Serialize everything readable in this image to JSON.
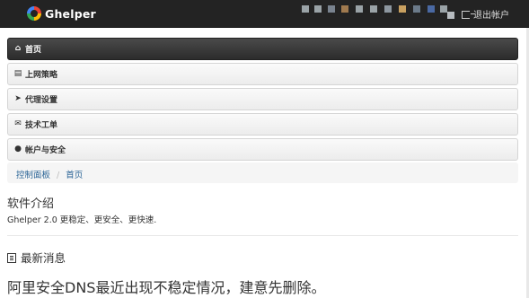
{
  "header": {
    "brand": "Ghelper",
    "logout_label": "退出帐户",
    "blocks": [
      {
        "color": "#9aa3a7"
      },
      {
        "color": "#9aa3a7"
      },
      {
        "color": "#79838f"
      },
      {
        "color": "#a07a4f"
      },
      {
        "color": "#9aa3a7"
      },
      {
        "color": "#9aa3a7"
      },
      {
        "color": "#8d97a0"
      },
      {
        "color": "#c8a060"
      },
      {
        "color": "#6b7a89"
      },
      {
        "color": "#4a69a3"
      },
      {
        "color": "#9aa3a7"
      },
      {
        "color": "#b7bcc0"
      }
    ]
  },
  "nav": {
    "items": [
      {
        "label": "首页",
        "icon": "home-icon",
        "active": true
      },
      {
        "label": "上网策略",
        "icon": "list-icon",
        "active": false
      },
      {
        "label": "代理设置",
        "icon": "send-icon",
        "active": false
      },
      {
        "label": "技术工单",
        "icon": "envelope-icon",
        "active": false
      },
      {
        "label": "帐户与安全",
        "icon": "user-icon",
        "active": false
      }
    ]
  },
  "breadcrumb": {
    "items": [
      "控制面板",
      "首页"
    ],
    "separator": "/"
  },
  "software": {
    "heading": "软件介绍",
    "description": "Ghelper 2.0 更稳定、更安全、更快速."
  },
  "news": {
    "heading": "最新消息",
    "body": "阿里安全DNS最近出现不稳定情况，建意先删除。"
  }
}
